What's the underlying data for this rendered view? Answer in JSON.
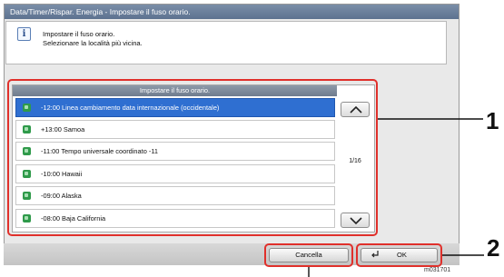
{
  "window": {
    "title": "Data/Timer/Rispar. Energia - Impostare il fuso orario."
  },
  "info": {
    "icon": "info-icon",
    "line1": "Impostare il fuso orario.",
    "line2": "Selezionare la località più vicina."
  },
  "list": {
    "header": "Impostare il fuso orario.",
    "items": [
      {
        "label": "-12:00 Linea cambiamento data internazionale (occidentale)",
        "selected": true
      },
      {
        "label": "+13:00 Samoa",
        "selected": false
      },
      {
        "label": "-11:00 Tempo universale coordinato -11",
        "selected": false
      },
      {
        "label": "-10:00 Hawaii",
        "selected": false
      },
      {
        "label": "-09:00 Alaska",
        "selected": false
      },
      {
        "label": "-08:00 Baja California",
        "selected": false
      }
    ],
    "page_indicator": "1/16"
  },
  "buttons": {
    "cancel_label": "Cancella",
    "ok_label": "OK"
  },
  "callouts": {
    "one": "1",
    "two": "2"
  },
  "figure_code": "m031701",
  "colors": {
    "selected_row": "#2f6fd1",
    "highlight": "#e0302b",
    "title_bar": "#6a7f9c"
  }
}
